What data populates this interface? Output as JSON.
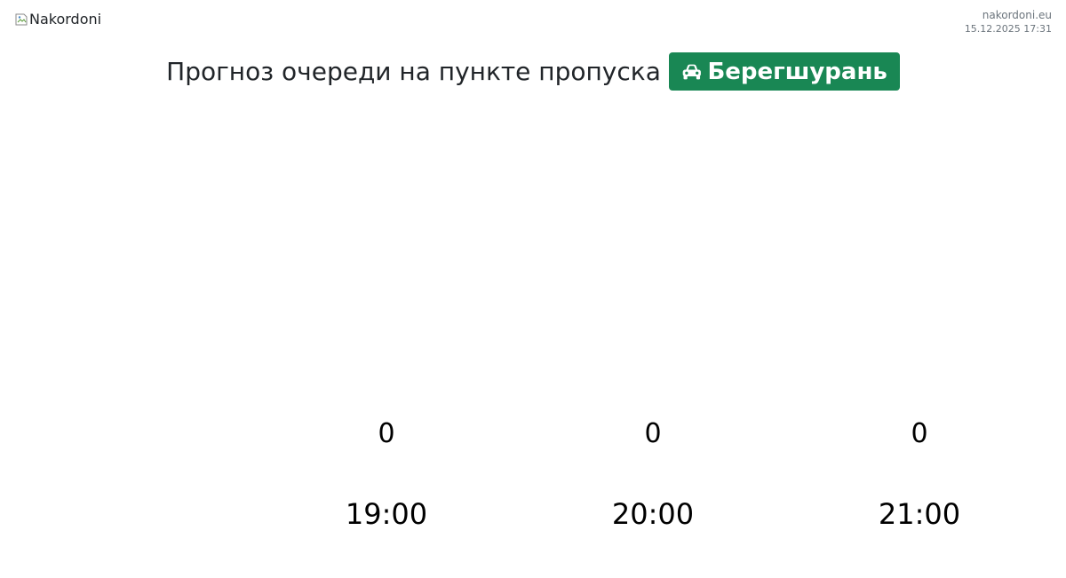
{
  "logo": {
    "alt": "Nakordoni",
    "icon": "broken-image-icon"
  },
  "meta": {
    "site": "nakordoni.eu",
    "datetime": "15.12.2025 17:31"
  },
  "heading": {
    "text": "Прогноз очереди на пункте пропуска",
    "checkpoint": "Берегшурань",
    "checkpoint_icon": "car-icon",
    "badge_color": "#198754"
  },
  "forecast": [
    {
      "count": "0",
      "time": "19:00"
    },
    {
      "count": "0",
      "time": "20:00"
    },
    {
      "count": "0",
      "time": "21:00"
    }
  ]
}
